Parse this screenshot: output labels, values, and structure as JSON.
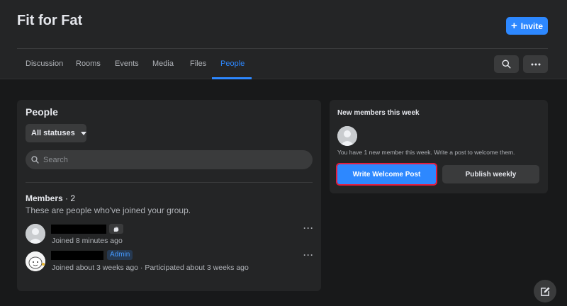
{
  "header": {
    "group_name": "Fit for Fat",
    "invite_label": "Invite",
    "tabs": [
      {
        "label": "Discussion",
        "active": false
      },
      {
        "label": "Rooms",
        "active": false
      },
      {
        "label": "Events",
        "active": false
      },
      {
        "label": "Media",
        "active": false
      },
      {
        "label": "Files",
        "active": false
      },
      {
        "label": "People",
        "active": true
      }
    ],
    "search_icon": "search-icon",
    "more_icon": "more-horizontal-icon"
  },
  "people": {
    "title": "People",
    "status_filter": "All statuses",
    "search_placeholder": "Search",
    "members_label": "Members",
    "members_separator": " · ",
    "members_count": "2",
    "members_description": "These are people who've joined your group.",
    "members": [
      {
        "name": "",
        "badge_icon": "new-member-wave-icon",
        "meta": "Joined 8 minutes ago"
      },
      {
        "name": "",
        "badge": "Admin",
        "meta": "Joined about 3 weeks ago · Participated about 3 weeks ago"
      }
    ]
  },
  "new_members": {
    "title": "New members this week",
    "description": "You have 1 new member this week. Write a post to welcome them.",
    "write_button": "Write Welcome Post",
    "publish_button": "Publish weekly"
  },
  "colors": {
    "accent": "#2d88ff",
    "background": "#18191a",
    "card": "#242526",
    "highlight_outline": "#e41e3f"
  },
  "floating": {
    "compose_icon": "compose-edit-icon"
  }
}
